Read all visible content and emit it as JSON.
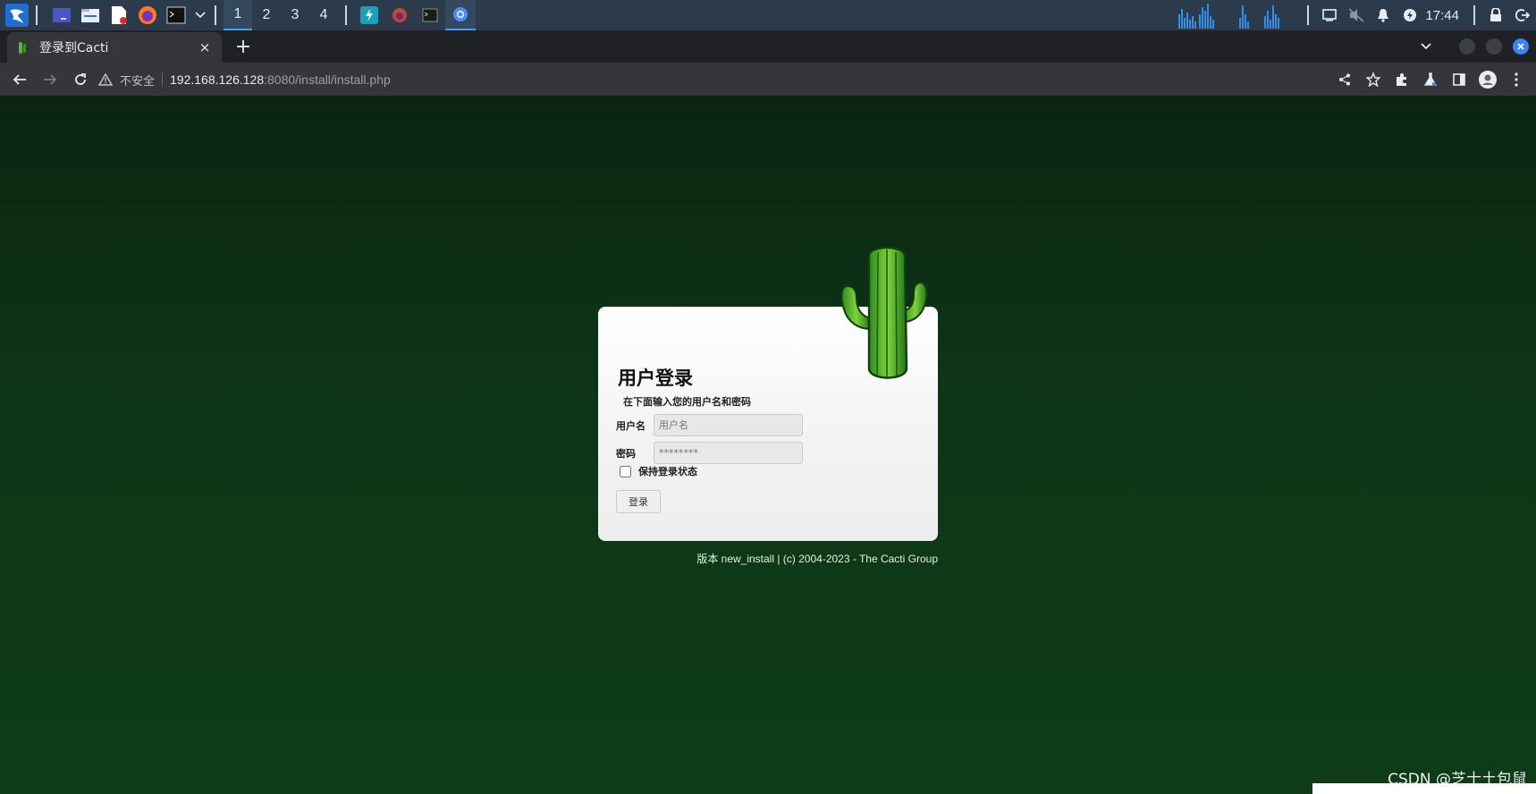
{
  "taskbar": {
    "workspaces": [
      "1",
      "2",
      "3",
      "4"
    ],
    "clock": "17:44",
    "icons": [
      "kali-menu-icon",
      "desktop-icon",
      "files-icon",
      "text-editor-icon",
      "firefox-icon",
      "terminal-icon",
      "dropdown-icon"
    ],
    "open_apps": [
      "app-bolt-icon",
      "app-firefox-icon",
      "app-terminal-icon",
      "app-chromium-icon"
    ],
    "tray_icons": [
      "display-icon",
      "mute-icon",
      "bell-icon",
      "power-icon",
      "lock-icon",
      "logout-icon"
    ]
  },
  "browser": {
    "tab_title": "登录到Cacti",
    "tab_close": "×",
    "new_tab": "+",
    "insecure_label": "不安全",
    "url_host": "192.168.126.128",
    "url_rest": ":8080/install/install.php"
  },
  "login": {
    "title": "用户登录",
    "subtitle": "在下面输入您的用户名和密码",
    "username_label": "用户名",
    "username_placeholder": "用户名",
    "password_label": "密码",
    "password_placeholder": "********",
    "remember_label": "保持登录状态",
    "login_button": "登录"
  },
  "footer": {
    "version": "版本 new_install | (c) 2004-2023 - The Cacti Group"
  },
  "watermark": "CSDN @芝士土包鼠",
  "colors": {
    "page_bg": "#0d3516",
    "taskbar_bg": "#2b3b4c",
    "browser_bg": "#35363a",
    "accent": "#3aa0ff"
  }
}
